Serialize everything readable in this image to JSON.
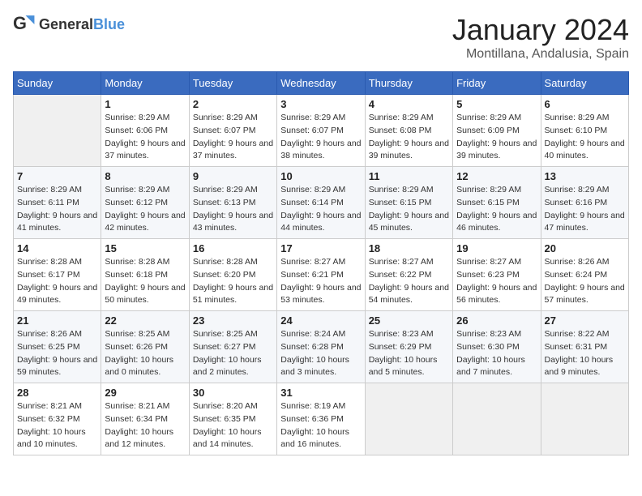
{
  "header": {
    "logo_general": "General",
    "logo_blue": "Blue",
    "month_title": "January 2024",
    "location": "Montillana, Andalusia, Spain"
  },
  "days_of_week": [
    "Sunday",
    "Monday",
    "Tuesday",
    "Wednesday",
    "Thursday",
    "Friday",
    "Saturday"
  ],
  "weeks": [
    [
      {
        "day": "",
        "sunrise": "",
        "sunset": "",
        "daylight": ""
      },
      {
        "day": "1",
        "sunrise": "Sunrise: 8:29 AM",
        "sunset": "Sunset: 6:06 PM",
        "daylight": "Daylight: 9 hours and 37 minutes."
      },
      {
        "day": "2",
        "sunrise": "Sunrise: 8:29 AM",
        "sunset": "Sunset: 6:07 PM",
        "daylight": "Daylight: 9 hours and 37 minutes."
      },
      {
        "day": "3",
        "sunrise": "Sunrise: 8:29 AM",
        "sunset": "Sunset: 6:07 PM",
        "daylight": "Daylight: 9 hours and 38 minutes."
      },
      {
        "day": "4",
        "sunrise": "Sunrise: 8:29 AM",
        "sunset": "Sunset: 6:08 PM",
        "daylight": "Daylight: 9 hours and 39 minutes."
      },
      {
        "day": "5",
        "sunrise": "Sunrise: 8:29 AM",
        "sunset": "Sunset: 6:09 PM",
        "daylight": "Daylight: 9 hours and 39 minutes."
      },
      {
        "day": "6",
        "sunrise": "Sunrise: 8:29 AM",
        "sunset": "Sunset: 6:10 PM",
        "daylight": "Daylight: 9 hours and 40 minutes."
      }
    ],
    [
      {
        "day": "7",
        "sunrise": "Sunrise: 8:29 AM",
        "sunset": "Sunset: 6:11 PM",
        "daylight": "Daylight: 9 hours and 41 minutes."
      },
      {
        "day": "8",
        "sunrise": "Sunrise: 8:29 AM",
        "sunset": "Sunset: 6:12 PM",
        "daylight": "Daylight: 9 hours and 42 minutes."
      },
      {
        "day": "9",
        "sunrise": "Sunrise: 8:29 AM",
        "sunset": "Sunset: 6:13 PM",
        "daylight": "Daylight: 9 hours and 43 minutes."
      },
      {
        "day": "10",
        "sunrise": "Sunrise: 8:29 AM",
        "sunset": "Sunset: 6:14 PM",
        "daylight": "Daylight: 9 hours and 44 minutes."
      },
      {
        "day": "11",
        "sunrise": "Sunrise: 8:29 AM",
        "sunset": "Sunset: 6:15 PM",
        "daylight": "Daylight: 9 hours and 45 minutes."
      },
      {
        "day": "12",
        "sunrise": "Sunrise: 8:29 AM",
        "sunset": "Sunset: 6:15 PM",
        "daylight": "Daylight: 9 hours and 46 minutes."
      },
      {
        "day": "13",
        "sunrise": "Sunrise: 8:29 AM",
        "sunset": "Sunset: 6:16 PM",
        "daylight": "Daylight: 9 hours and 47 minutes."
      }
    ],
    [
      {
        "day": "14",
        "sunrise": "Sunrise: 8:28 AM",
        "sunset": "Sunset: 6:17 PM",
        "daylight": "Daylight: 9 hours and 49 minutes."
      },
      {
        "day": "15",
        "sunrise": "Sunrise: 8:28 AM",
        "sunset": "Sunset: 6:18 PM",
        "daylight": "Daylight: 9 hours and 50 minutes."
      },
      {
        "day": "16",
        "sunrise": "Sunrise: 8:28 AM",
        "sunset": "Sunset: 6:20 PM",
        "daylight": "Daylight: 9 hours and 51 minutes."
      },
      {
        "day": "17",
        "sunrise": "Sunrise: 8:27 AM",
        "sunset": "Sunset: 6:21 PM",
        "daylight": "Daylight: 9 hours and 53 minutes."
      },
      {
        "day": "18",
        "sunrise": "Sunrise: 8:27 AM",
        "sunset": "Sunset: 6:22 PM",
        "daylight": "Daylight: 9 hours and 54 minutes."
      },
      {
        "day": "19",
        "sunrise": "Sunrise: 8:27 AM",
        "sunset": "Sunset: 6:23 PM",
        "daylight": "Daylight: 9 hours and 56 minutes."
      },
      {
        "day": "20",
        "sunrise": "Sunrise: 8:26 AM",
        "sunset": "Sunset: 6:24 PM",
        "daylight": "Daylight: 9 hours and 57 minutes."
      }
    ],
    [
      {
        "day": "21",
        "sunrise": "Sunrise: 8:26 AM",
        "sunset": "Sunset: 6:25 PM",
        "daylight": "Daylight: 9 hours and 59 minutes."
      },
      {
        "day": "22",
        "sunrise": "Sunrise: 8:25 AM",
        "sunset": "Sunset: 6:26 PM",
        "daylight": "Daylight: 10 hours and 0 minutes."
      },
      {
        "day": "23",
        "sunrise": "Sunrise: 8:25 AM",
        "sunset": "Sunset: 6:27 PM",
        "daylight": "Daylight: 10 hours and 2 minutes."
      },
      {
        "day": "24",
        "sunrise": "Sunrise: 8:24 AM",
        "sunset": "Sunset: 6:28 PM",
        "daylight": "Daylight: 10 hours and 3 minutes."
      },
      {
        "day": "25",
        "sunrise": "Sunrise: 8:23 AM",
        "sunset": "Sunset: 6:29 PM",
        "daylight": "Daylight: 10 hours and 5 minutes."
      },
      {
        "day": "26",
        "sunrise": "Sunrise: 8:23 AM",
        "sunset": "Sunset: 6:30 PM",
        "daylight": "Daylight: 10 hours and 7 minutes."
      },
      {
        "day": "27",
        "sunrise": "Sunrise: 8:22 AM",
        "sunset": "Sunset: 6:31 PM",
        "daylight": "Daylight: 10 hours and 9 minutes."
      }
    ],
    [
      {
        "day": "28",
        "sunrise": "Sunrise: 8:21 AM",
        "sunset": "Sunset: 6:32 PM",
        "daylight": "Daylight: 10 hours and 10 minutes."
      },
      {
        "day": "29",
        "sunrise": "Sunrise: 8:21 AM",
        "sunset": "Sunset: 6:34 PM",
        "daylight": "Daylight: 10 hours and 12 minutes."
      },
      {
        "day": "30",
        "sunrise": "Sunrise: 8:20 AM",
        "sunset": "Sunset: 6:35 PM",
        "daylight": "Daylight: 10 hours and 14 minutes."
      },
      {
        "day": "31",
        "sunrise": "Sunrise: 8:19 AM",
        "sunset": "Sunset: 6:36 PM",
        "daylight": "Daylight: 10 hours and 16 minutes."
      },
      {
        "day": "",
        "sunrise": "",
        "sunset": "",
        "daylight": ""
      },
      {
        "day": "",
        "sunrise": "",
        "sunset": "",
        "daylight": ""
      },
      {
        "day": "",
        "sunrise": "",
        "sunset": "",
        "daylight": ""
      }
    ]
  ]
}
